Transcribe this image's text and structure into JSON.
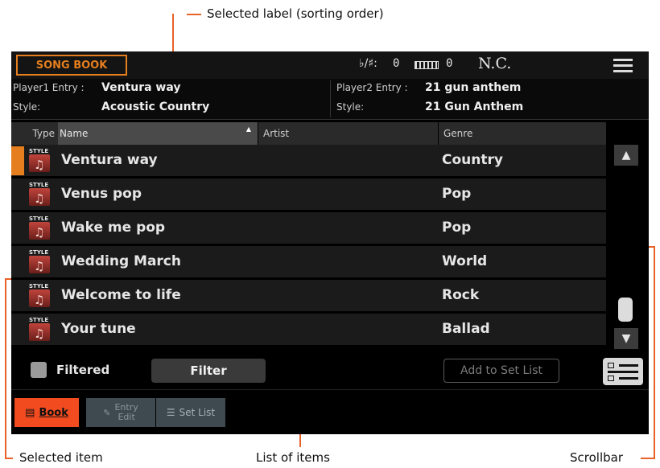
{
  "callouts": {
    "selected_label": "Selected label (sorting order)",
    "selected_item": "Selected item",
    "list_of_items": "List of items",
    "scrollbar": "Scrollbar"
  },
  "topbar": {
    "title": "SONG BOOK",
    "transpose_label": "♭/♯:",
    "transpose_value": "0",
    "octave_value": "0",
    "chord": "N.C.",
    "icons": {
      "keyboard": "keyboard-icon",
      "menu": "menu-icon"
    }
  },
  "entries": {
    "player1_label": "Player1 Entry :",
    "player1_value": "Ventura way",
    "player1_style_label": "Style:",
    "player1_style_value": "Acoustic Country",
    "player2_label": "Player2 Entry :",
    "player2_value": "21 gun anthem",
    "player2_style_label": "Style:",
    "player2_style_value": "21 Gun Anthem"
  },
  "columns": {
    "type": "Type",
    "name": "Name",
    "artist": "Artist",
    "genre": "Genre"
  },
  "rows": [
    {
      "type_tag": "STYLE",
      "name": "Ventura way",
      "artist": "",
      "genre": "Country"
    },
    {
      "type_tag": "STYLE",
      "name": "Venus pop",
      "artist": "",
      "genre": "Pop"
    },
    {
      "type_tag": "STYLE",
      "name": "Wake me pop",
      "artist": "",
      "genre": "Pop"
    },
    {
      "type_tag": "STYLE",
      "name": "Wedding March",
      "artist": "",
      "genre": "World"
    },
    {
      "type_tag": "STYLE",
      "name": "Welcome to life",
      "artist": "",
      "genre": "Rock"
    },
    {
      "type_tag": "STYLE",
      "name": "Your tune",
      "artist": "",
      "genre": "Ballad"
    }
  ],
  "selected_row": 0,
  "controls": {
    "filtered_label": "Filtered",
    "filter_button": "Filter",
    "add_button": "Add to Set List"
  },
  "tabs": {
    "book": "Book",
    "entry_line1": "Entry",
    "entry_line2": "Edit",
    "setlist": "Set List"
  },
  "colors": {
    "accent": "#e57e1e",
    "active_tab": "#f24b1f",
    "callout_line": "#e8622a"
  }
}
